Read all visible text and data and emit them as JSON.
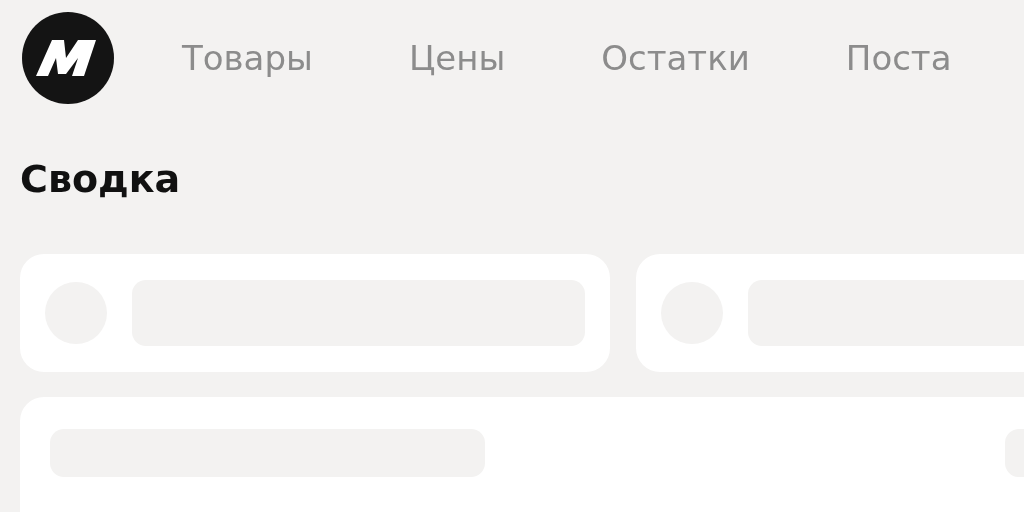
{
  "nav": {
    "items": [
      {
        "label": "Товары"
      },
      {
        "label": "Цены"
      },
      {
        "label": "Остатки"
      },
      {
        "label": "Поста"
      }
    ]
  },
  "heading": "Сводка"
}
